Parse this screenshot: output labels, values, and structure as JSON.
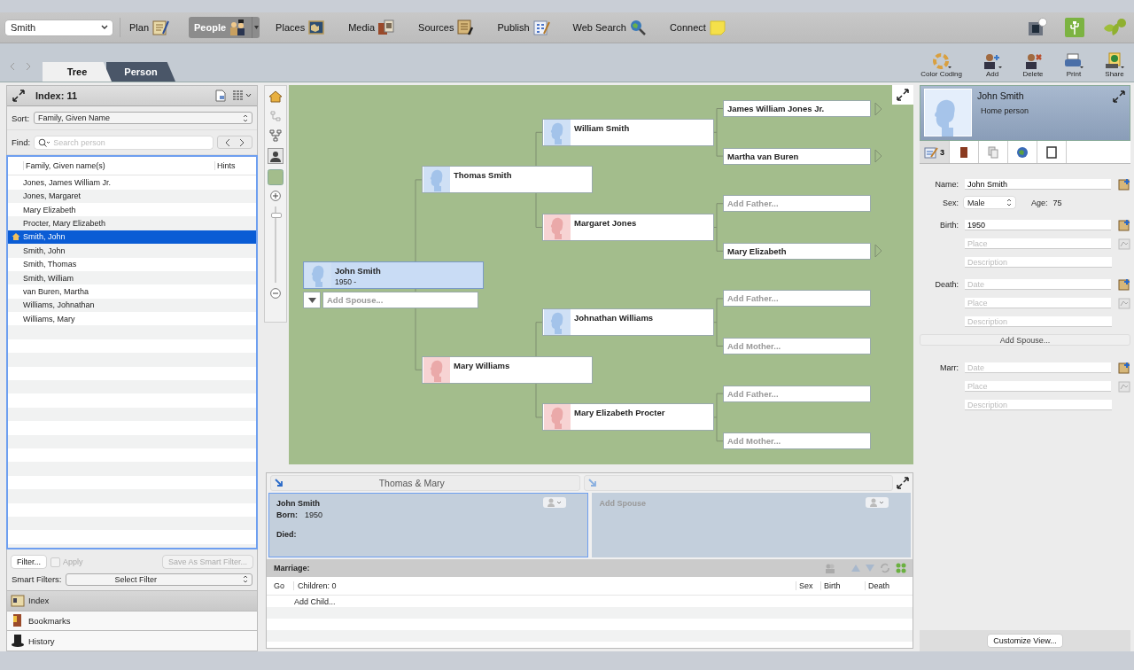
{
  "toolbar": {
    "family": "Smith",
    "items": [
      {
        "label": "Plan",
        "selected": false
      },
      {
        "label": "People",
        "selected": true
      },
      {
        "label": "Places",
        "selected": false
      },
      {
        "label": "Media",
        "selected": false
      },
      {
        "label": "Sources",
        "selected": false
      },
      {
        "label": "Publish",
        "selected": false
      },
      {
        "label": "Web Search",
        "selected": false
      },
      {
        "label": "Connect",
        "selected": false
      }
    ]
  },
  "view_tabs": [
    {
      "label": "Tree",
      "selected": true
    },
    {
      "label": "Person",
      "selected": false
    }
  ],
  "actions": [
    "Color Coding",
    "Add",
    "Delete",
    "Print",
    "Share"
  ],
  "index_panel": {
    "title": "Index: 11",
    "sort_label": "Sort:",
    "sort": "Family, Given Name",
    "find_label": "Find:",
    "find_placeholder": "Search person",
    "columns": [
      "Family, Given name(s)",
      "Hints"
    ],
    "rows": [
      {
        "name": "Jones, James William Jr.",
        "selected": false,
        "home": false
      },
      {
        "name": "Jones, Margaret",
        "selected": false,
        "home": false
      },
      {
        "name": "Mary Elizabeth",
        "selected": false,
        "home": false
      },
      {
        "name": "Procter, Mary Elizabeth",
        "selected": false,
        "home": false
      },
      {
        "name": "Smith, John",
        "selected": true,
        "home": true
      },
      {
        "name": "Smith, John",
        "selected": false,
        "home": false
      },
      {
        "name": "Smith, Thomas",
        "selected": false,
        "home": false
      },
      {
        "name": "Smith, William",
        "selected": false,
        "home": false
      },
      {
        "name": "van Buren, Martha",
        "selected": false,
        "home": false
      },
      {
        "name": "Williams, Johnathan",
        "selected": false,
        "home": false
      },
      {
        "name": "Williams, Mary",
        "selected": false,
        "home": false
      }
    ],
    "filter_button": "Filter...",
    "apply": {
      "label": "Apply",
      "checked": false
    },
    "save_smart_filter": "Save As Smart Filter...",
    "smart_filters_label": "Smart Filters:",
    "smart_filter": "Select Filter",
    "sections": [
      {
        "label": "Index",
        "selected": true
      },
      {
        "label": "Bookmarks",
        "selected": false
      },
      {
        "label": "History",
        "selected": false
      }
    ]
  },
  "zoom": {
    "level": 0.88
  },
  "tree": {
    "root": {
      "kind": "person",
      "name": "John Smith",
      "dates": "1950 -",
      "female": false,
      "selected": true,
      "add_spouse": "Add Spouse...",
      "parents": [
        {
          "kind": "person",
          "name": "Thomas Smith",
          "female": false,
          "selected": false,
          "parents": [
            {
              "kind": "person",
              "name": "William Smith",
              "female": false,
              "selected": false,
              "parents": [
                {
                  "kind": "person",
                  "name": "James William Jones Jr.",
                  "selected": false,
                  "more": true
                },
                {
                  "kind": "person",
                  "name": "Martha van Buren",
                  "selected": false,
                  "more": true
                }
              ]
            },
            {
              "kind": "person",
              "name": "Margaret Jones",
              "female": true,
              "selected": false,
              "parents": [
                {
                  "kind": "add",
                  "label": "Add Father..."
                },
                {
                  "kind": "person",
                  "name": "Mary Elizabeth",
                  "selected": false,
                  "more": true
                }
              ]
            }
          ]
        },
        {
          "kind": "person",
          "name": "Mary Williams",
          "female": true,
          "selected": false,
          "parents": [
            {
              "kind": "person",
              "name": "Johnathan Williams",
              "female": false,
              "selected": false,
              "parents": [
                {
                  "kind": "add",
                  "label": "Add Father..."
                },
                {
                  "kind": "add",
                  "label": "Add Mother..."
                }
              ]
            },
            {
              "kind": "person",
              "name": "Mary Elizabeth Procter",
              "female": true,
              "selected": false,
              "parents": [
                {
                  "kind": "add",
                  "label": "Add Father..."
                },
                {
                  "kind": "add",
                  "label": "Add Mother..."
                }
              ]
            }
          ]
        }
      ]
    }
  },
  "family": {
    "title": "Thomas & Mary",
    "partners": [
      {
        "kind": "person",
        "name": "John Smith",
        "born_label": "Born:",
        "born": "1950",
        "died_label": "Died:",
        "selected": true
      },
      {
        "kind": "add",
        "label": "Add Spouse",
        "selected": false
      }
    ],
    "marriage_label": "Marriage:",
    "columns": [
      "Go",
      "Children: 0",
      "Sex",
      "Birth",
      "Death"
    ],
    "add_child": "Add Child..."
  },
  "person": {
    "name": "John Smith",
    "subtitle": "Home person",
    "tabs": [
      {
        "count": "3",
        "selected": true
      },
      {
        "selected": false
      },
      {
        "selected": false
      },
      {
        "selected": false
      },
      {
        "selected": false
      }
    ],
    "name_label": "Name:",
    "name_value": "John Smith",
    "sex_label": "Sex:",
    "sex": "Male",
    "age_label": "Age:",
    "age": "75",
    "events": [
      {
        "label": "Birth:",
        "date": {
          "value": "1950"
        },
        "place": {
          "placeholder": "Place"
        },
        "description": {
          "placeholder": "Description"
        }
      },
      {
        "label": "Death:",
        "date": {
          "placeholder": "Date"
        },
        "place": {
          "placeholder": "Place"
        },
        "description": {
          "placeholder": "Description"
        }
      }
    ],
    "add_spouse": "Add Spouse...",
    "marriage": {
      "label": "Marr:",
      "date": {
        "placeholder": "Date"
      },
      "place": {
        "placeholder": "Place"
      },
      "description": {
        "placeholder": "Description"
      }
    },
    "customize": "Customize View..."
  }
}
